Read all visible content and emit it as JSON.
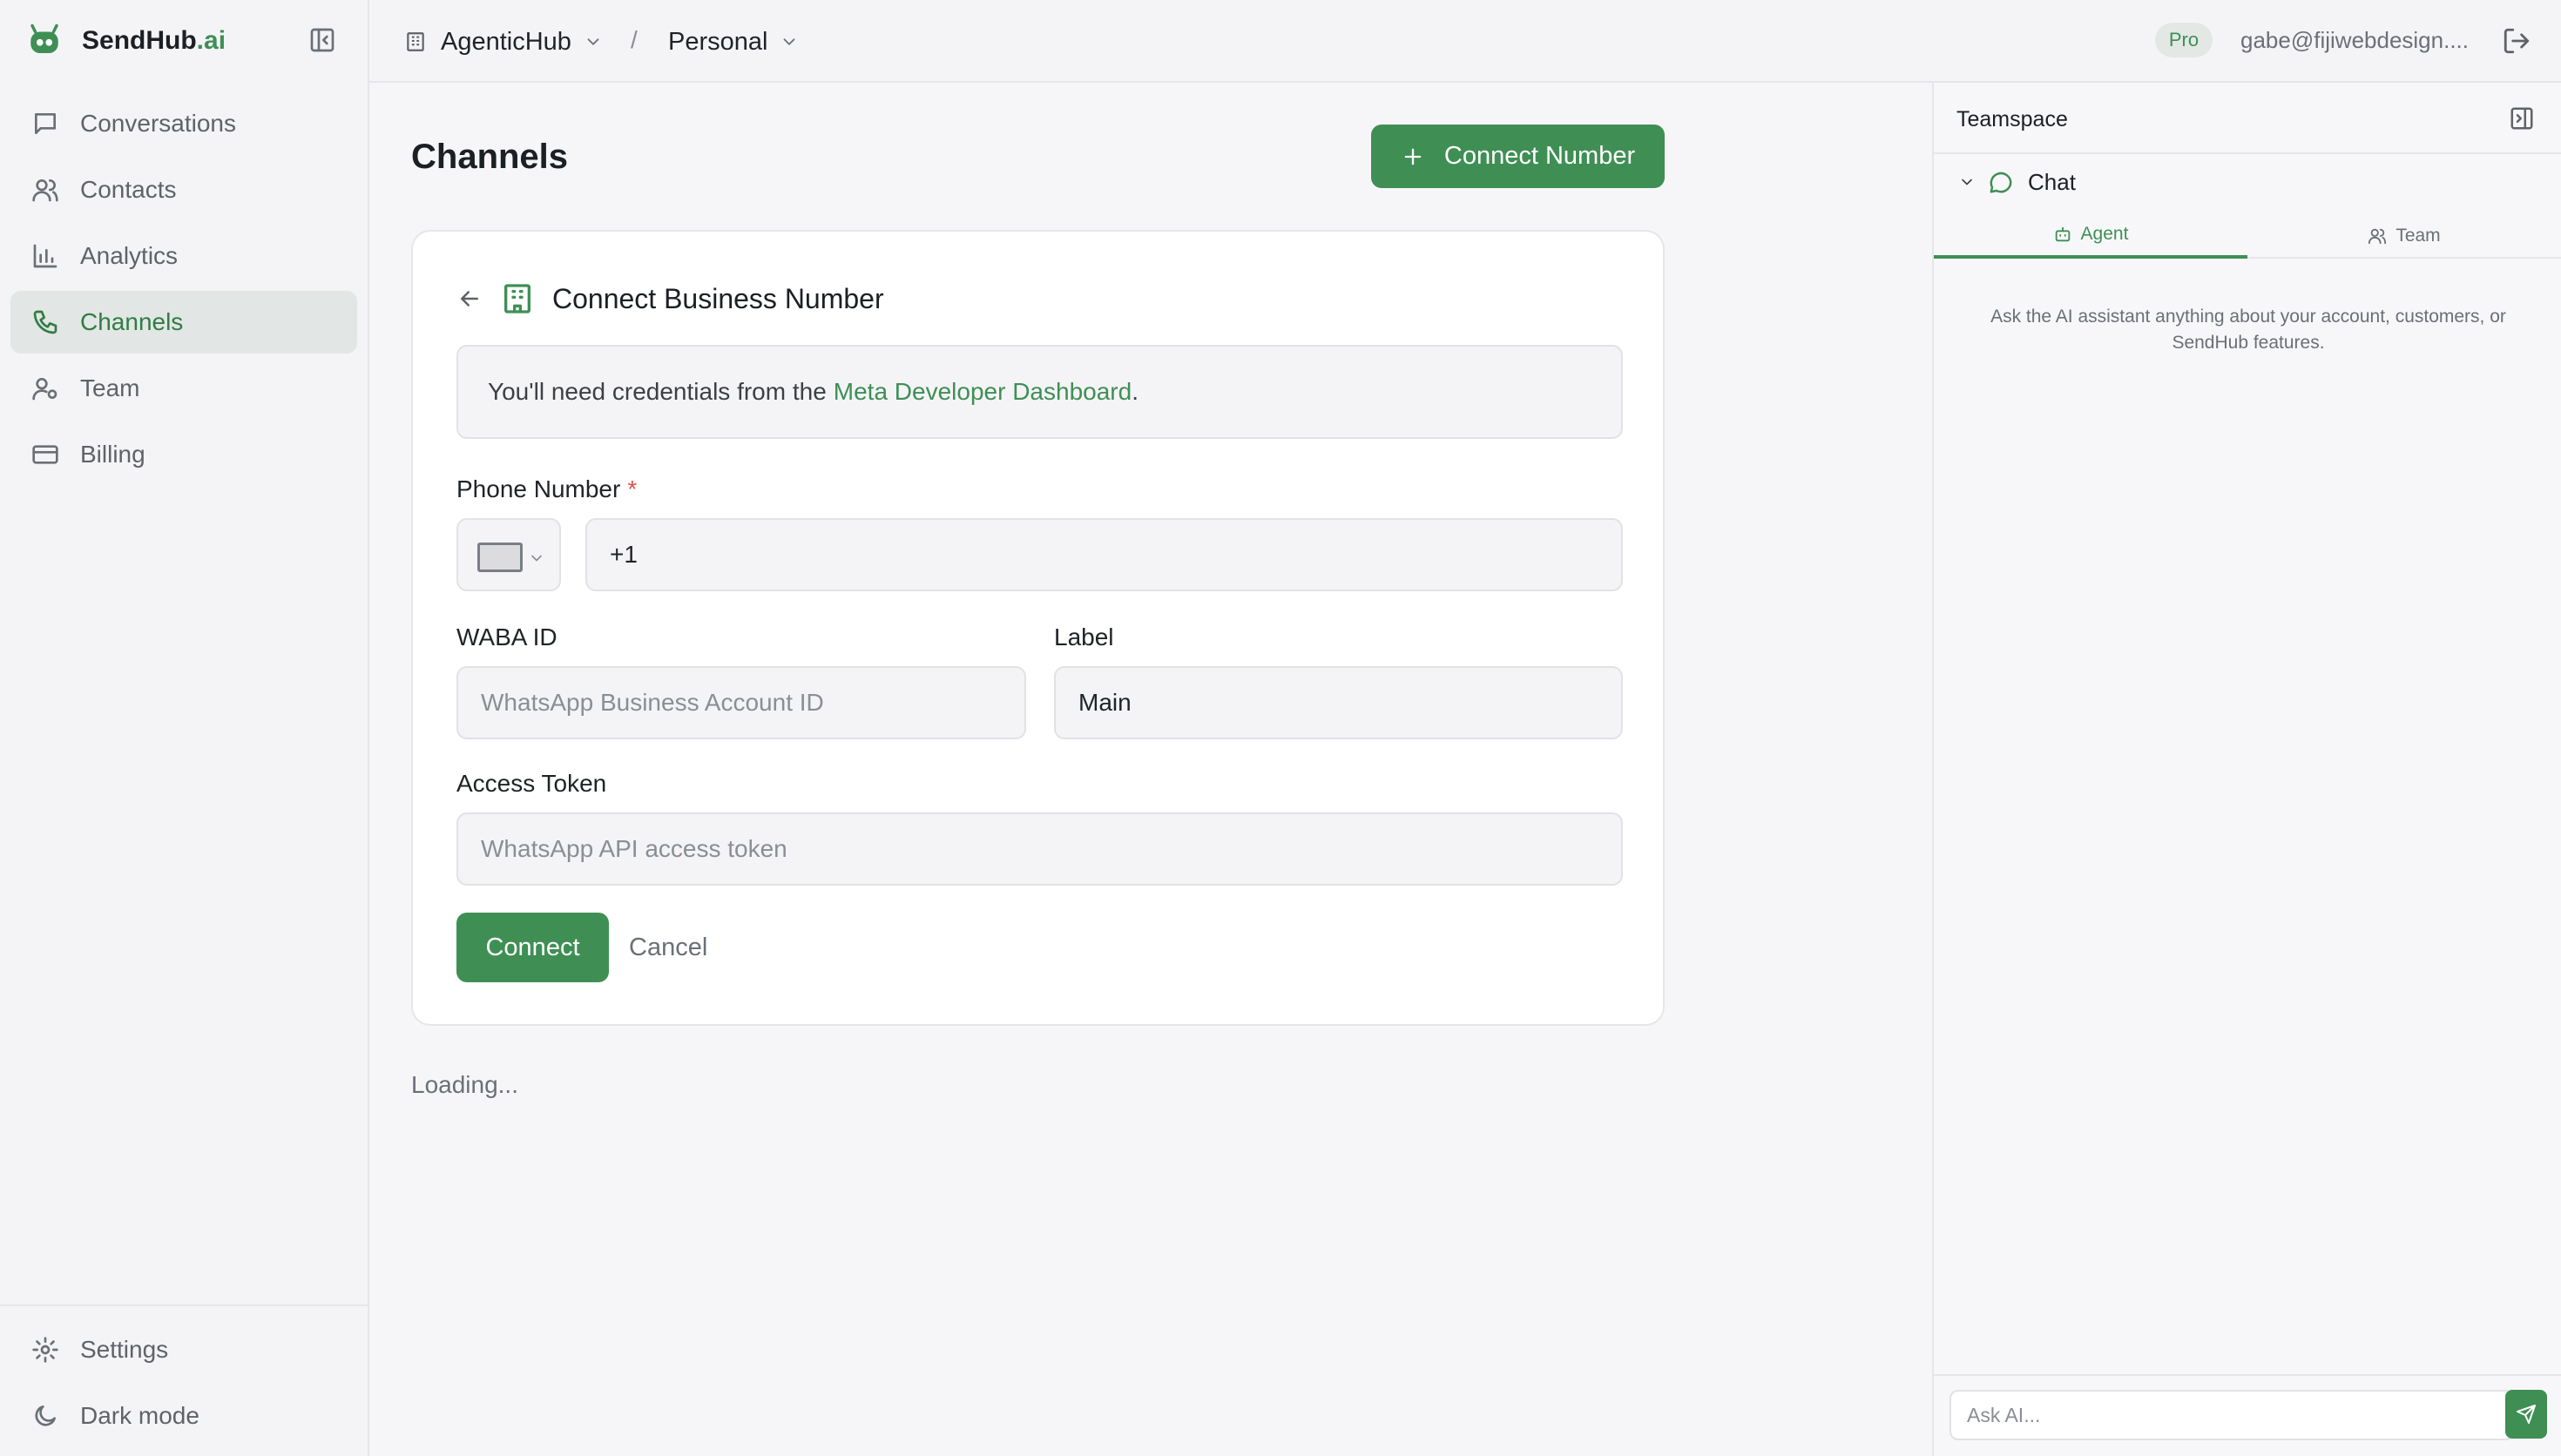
{
  "app": {
    "brand_main": "SendHub",
    "brand_suffix": ".ai"
  },
  "sidebar": {
    "items": [
      {
        "label": "Conversations",
        "icon": "chat-bubble-icon"
      },
      {
        "label": "Contacts",
        "icon": "users-icon"
      },
      {
        "label": "Analytics",
        "icon": "bar-chart-icon"
      },
      {
        "label": "Channels",
        "icon": "phone-icon",
        "active": true
      },
      {
        "label": "Team",
        "icon": "user-cog-icon"
      },
      {
        "label": "Billing",
        "icon": "credit-card-icon"
      }
    ],
    "bottom": [
      {
        "label": "Settings",
        "icon": "gear-icon"
      },
      {
        "label": "Dark mode",
        "icon": "moon-icon"
      }
    ]
  },
  "topbar": {
    "org": "AgenticHub",
    "separator": "/",
    "workspace": "Personal",
    "plan_badge": "Pro",
    "user_email": "gabe@fijiwebdesign...."
  },
  "main": {
    "title": "Channels",
    "connect_number_label": "Connect Number",
    "card": {
      "title": "Connect Business Number",
      "notice_prefix": "You'll need credentials from the",
      "notice_link": "Meta Developer Dashboard",
      "notice_suffix": ".",
      "phone_label": "Phone Number",
      "required_mark": "*",
      "phone_value": "+1",
      "waba_label": "WABA ID",
      "waba_placeholder": "WhatsApp Business Account ID",
      "label_label": "Label",
      "label_value": "Main",
      "token_label": "Access Token",
      "token_placeholder": "WhatsApp API access token",
      "connect_label": "Connect",
      "cancel_label": "Cancel"
    },
    "loading_text": "Loading..."
  },
  "right_panel": {
    "title": "Teamspace",
    "section": "Chat",
    "tabs": [
      {
        "label": "Agent",
        "icon": "bot-icon",
        "active": true
      },
      {
        "label": "Team",
        "icon": "users-icon"
      }
    ],
    "hint": "Ask the AI assistant anything about your account, customers, or SendHub features.",
    "input_placeholder": "Ask AI..."
  },
  "colors": {
    "accent": "#3f8f55",
    "background": "#f6f6f9",
    "card": "#ffffff"
  }
}
